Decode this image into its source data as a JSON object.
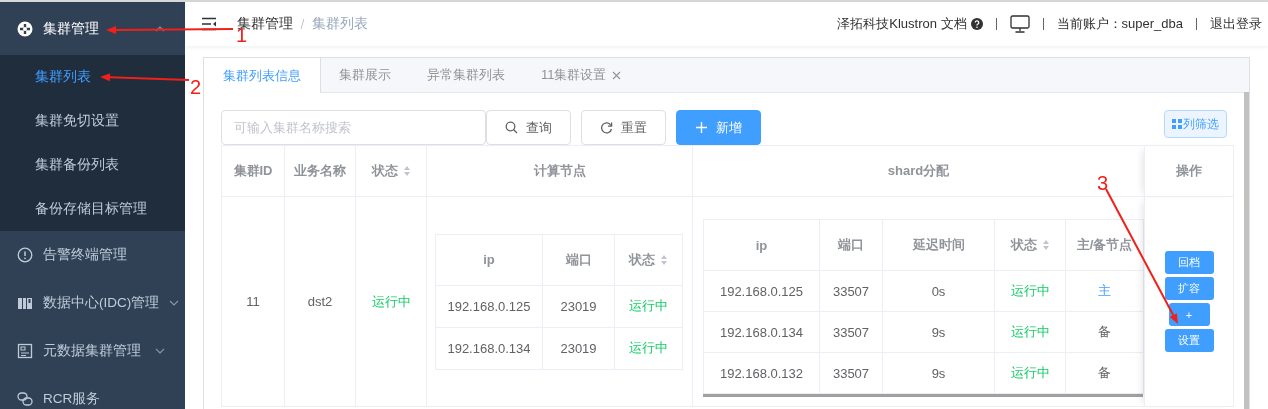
{
  "sidebar": {
    "items": [
      {
        "kind": "group",
        "label": "集群管理",
        "expanded": true,
        "children": [
          {
            "label": "集群列表",
            "selected": true
          },
          {
            "label": "集群免切设置",
            "selected": false
          },
          {
            "label": "集群备份列表",
            "selected": false
          },
          {
            "label": "备份存储目标管理",
            "selected": false
          }
        ]
      },
      {
        "kind": "item",
        "label": "告警终端管理",
        "selected": false
      },
      {
        "kind": "group",
        "label": "数据中心(IDC)管理",
        "expanded": false
      },
      {
        "kind": "group",
        "label": "元数据集群管理",
        "expanded": false
      },
      {
        "kind": "item",
        "label": "RCR服务",
        "selected": false
      }
    ]
  },
  "header": {
    "breadcrumb": [
      {
        "label": "集群管理",
        "current": false
      },
      {
        "label": "集群列表",
        "current": true
      }
    ],
    "docs_link": "泽拓科技Klustron 文档",
    "account": "当前账户：super_dba",
    "logout": "退出登录"
  },
  "tabs": [
    {
      "label": "集群列表信息",
      "selected": true,
      "closable": false
    },
    {
      "label": "集群展示",
      "selected": false,
      "closable": false
    },
    {
      "label": "异常集群列表",
      "selected": false,
      "closable": false
    },
    {
      "label": "11集群设置",
      "selected": false,
      "closable": true
    }
  ],
  "toolbar": {
    "search": {
      "placeholder": "可输入集群名称搜索"
    },
    "buttons": [
      {
        "label": "查询",
        "kind": "default"
      },
      {
        "label": "重置",
        "kind": "default"
      },
      {
        "label": "新增",
        "kind": "primary"
      }
    ],
    "column_filter": "列筛选"
  },
  "table": {
    "columns": [
      {
        "label": "集群ID",
        "sortable": false
      },
      {
        "label": "业务名称",
        "sortable": false
      },
      {
        "label": "状态",
        "sortable": true
      },
      {
        "label": "计算节点",
        "sortable": false
      },
      {
        "label": "shard分配",
        "sortable": false
      },
      {
        "label": "操作",
        "sortable": false
      }
    ],
    "rows": [
      {
        "id": "11",
        "name": "dst2",
        "status": "运行中",
        "running": true,
        "compute_nodes": {
          "columns": [
            {
              "label": "ip",
              "sortable": false
            },
            {
              "label": "端口",
              "sortable": false
            },
            {
              "label": "状态",
              "sortable": true
            }
          ],
          "rows": [
            {
              "ip": "192.168.0.125",
              "port": "23019",
              "status": "运行中",
              "running": true
            },
            {
              "ip": "192.168.0.134",
              "port": "23019",
              "status": "运行中",
              "running": true
            }
          ]
        },
        "shards": {
          "columns": [
            {
              "label": "ip",
              "sortable": false
            },
            {
              "label": "端口",
              "sortable": false
            },
            {
              "label": "延迟时间",
              "sortable": false
            },
            {
              "label": "状态",
              "sortable": true
            },
            {
              "label": "主/备节点",
              "sortable": false
            }
          ],
          "rows": [
            {
              "ip": "192.168.0.125",
              "port": "33507",
              "delay": "0s",
              "status": "运行中",
              "running": true,
              "role": "主",
              "primary": true
            },
            {
              "ip": "192.168.0.134",
              "port": "33507",
              "delay": "9s",
              "status": "运行中",
              "running": true,
              "role": "备",
              "primary": false
            },
            {
              "ip": "192.168.0.132",
              "port": "33507",
              "delay": "9s",
              "status": "运行中",
              "running": true,
              "role": "备",
              "primary": false
            }
          ]
        },
        "actions": [
          {
            "label": "回档",
            "kind": "wide"
          },
          {
            "label": "扩容",
            "kind": "wide"
          },
          {
            "label": "+",
            "kind": "narrow"
          },
          {
            "label": "设置",
            "kind": "wide"
          }
        ]
      }
    ]
  },
  "annotations": [
    {
      "label": "1"
    },
    {
      "label": "2"
    },
    {
      "label": "3"
    }
  ]
}
